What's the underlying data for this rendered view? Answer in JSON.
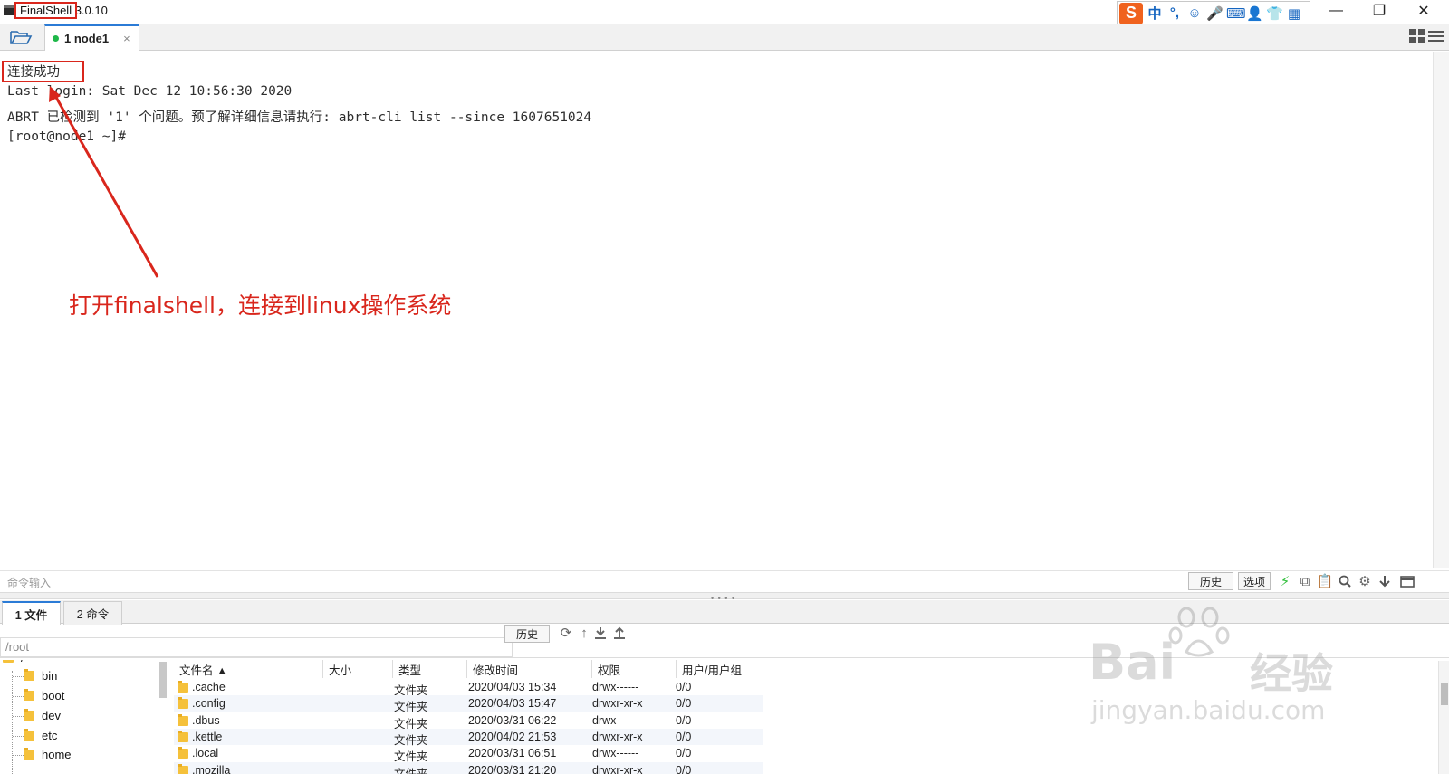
{
  "app": {
    "title": "FinalShell 3.0.10",
    "window_controls": {
      "minimize": "—",
      "restore": "❐",
      "close": "✕"
    }
  },
  "ime_toolbar": {
    "logo": "S",
    "items": [
      "中",
      "°,",
      "☺",
      "🎤",
      "⌨",
      "👤",
      "👕",
      "▦"
    ]
  },
  "session_tabs": [
    {
      "label": "1 node1",
      "status_color": "#1fb84a",
      "close": "×"
    }
  ],
  "terminal": {
    "lines": [
      "连接成功",
      "Last login: Sat Dec 12 10:56:30 2020",
      "ABRT 已检测到 '1' 个问题。预了解详细信息请执行: abrt-cli list --since 1607651024",
      "[root@node1 ~]#"
    ]
  },
  "annotation": {
    "text": "打开finalshell，连接到linux操作系统",
    "color": "#d9261c"
  },
  "command_bar": {
    "placeholder": "命令输入",
    "history_label": "历史",
    "options_label": "选项"
  },
  "bottom_tabs": [
    {
      "label": "1 文件",
      "active": true
    },
    {
      "label": "2 命令",
      "active": false
    }
  ],
  "file_browser": {
    "path": "/root",
    "history_label": "历史",
    "tree": [
      "/",
      "bin",
      "boot",
      "dev",
      "etc",
      "home"
    ],
    "columns": [
      "文件名 ▲",
      "大小",
      "类型",
      "修改时间",
      "权限",
      "用户/用户组"
    ],
    "rows": [
      {
        "name": ".cache",
        "size": "",
        "type": "文件夹",
        "modified": "2020/04/03 15:34",
        "perm": "drwx------",
        "owner": "0/0"
      },
      {
        "name": ".config",
        "size": "",
        "type": "文件夹",
        "modified": "2020/04/03 15:47",
        "perm": "drwxr-xr-x",
        "owner": "0/0"
      },
      {
        "name": ".dbus",
        "size": "",
        "type": "文件夹",
        "modified": "2020/03/31 06:22",
        "perm": "drwx------",
        "owner": "0/0"
      },
      {
        "name": ".kettle",
        "size": "",
        "type": "文件夹",
        "modified": "2020/04/02 21:53",
        "perm": "drwxr-xr-x",
        "owner": "0/0"
      },
      {
        "name": ".local",
        "size": "",
        "type": "文件夹",
        "modified": "2020/03/31 06:51",
        "perm": "drwx------",
        "owner": "0/0"
      },
      {
        "name": ".mozilla",
        "size": "",
        "type": "文件夹",
        "modified": "2020/03/31 21:20",
        "perm": "drwxr-xr-x",
        "owner": "0/0"
      }
    ]
  },
  "watermark": {
    "brand": "Bai",
    "brand2": "经验",
    "url": "jingyan.baidu.com"
  }
}
